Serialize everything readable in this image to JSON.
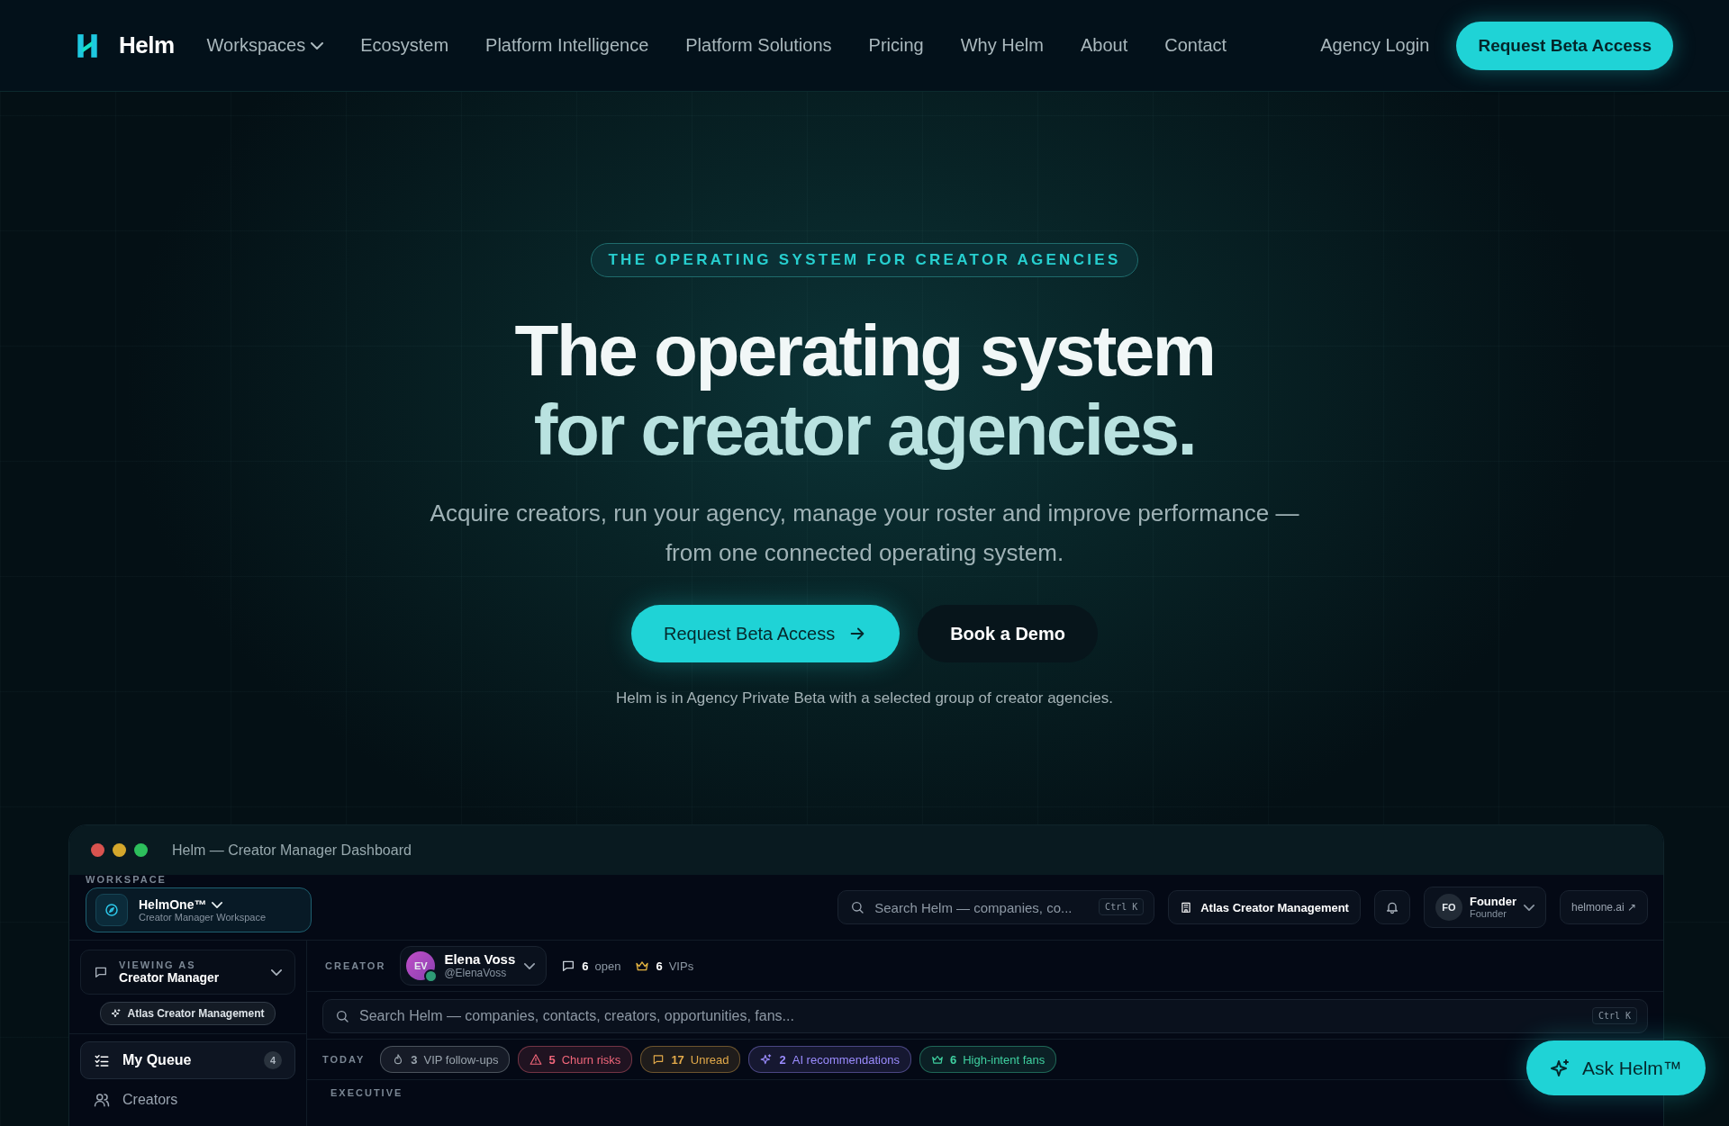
{
  "nav": {
    "logo": "Helm",
    "items": [
      {
        "label": "Workspaces",
        "dropdown": true
      },
      {
        "label": "Ecosystem",
        "dropdown": false
      },
      {
        "label": "Platform Intelligence",
        "dropdown": false
      },
      {
        "label": "Platform Solutions",
        "dropdown": false
      },
      {
        "label": "Pricing",
        "dropdown": false
      },
      {
        "label": "Why Helm",
        "dropdown": false
      },
      {
        "label": "About",
        "dropdown": false
      },
      {
        "label": "Contact",
        "dropdown": false
      }
    ],
    "login": "Agency Login",
    "cta": "Request Beta Access"
  },
  "hero": {
    "eyebrow": "THE OPERATING SYSTEM FOR CREATOR AGENCIES",
    "title_lines": [
      "The operating system",
      "for creator agencies."
    ],
    "subtitle": "Acquire creators, run your agency, manage your roster and improve performance — from one connected operating system.",
    "primary": "Request Beta Access",
    "secondary": "Book a Demo",
    "note": "Helm is in Agency Private Beta with a selected group of creator agencies."
  },
  "dashboard": {
    "title": "Helm — Creator Manager Dashboard",
    "workspace": {
      "label": "WORKSPACE",
      "name": "HelmOne™",
      "subtitle": "Creator Manager Workspace"
    },
    "topbar": {
      "search": {
        "placeholder": "Search Helm — companies, co...",
        "shortcut": "Ctrl K"
      },
      "org": "Atlas Creator Management",
      "user": {
        "initials": "FO",
        "name": "Founder",
        "role": "Founder"
      },
      "link": "helmone.ai ↗"
    },
    "sidebar": {
      "viewing": {
        "label": "VIEWING AS",
        "value": "Creator Manager"
      },
      "org_chip": "Atlas Creator Management",
      "items": [
        {
          "kind": "queue",
          "label": "My Queue",
          "count": "4",
          "selected": true
        },
        {
          "kind": "users",
          "label": "Creators",
          "selected": false
        }
      ]
    },
    "creator_bar": {
      "label": "CREATOR",
      "creator": {
        "initials": "EV",
        "name": "Elena Voss",
        "handle": "@ElenaVoss",
        "online": true
      },
      "stats": [
        {
          "kind": "chat",
          "value": "6",
          "label": "open"
        },
        {
          "kind": "crown",
          "value": "6",
          "label": "VIPs"
        }
      ]
    },
    "search": {
      "placeholder": "Search Helm — companies, contacts, creators, opportunities, fans...",
      "shortcut": "Ctrl K"
    },
    "today": {
      "label": "TODAY",
      "chips": [
        {
          "kind": "flame",
          "value": "3",
          "label": "VIP follow-ups",
          "color": "#9aa4ad"
        },
        {
          "kind": "alert",
          "value": "5",
          "label": "Churn risks",
          "color": "#f0667a"
        },
        {
          "kind": "chat",
          "value": "17",
          "label": "Unread",
          "color": "#e3aa4a"
        },
        {
          "kind": "sparkle",
          "value": "2",
          "label": "AI recommendations",
          "color": "#9b8cff"
        },
        {
          "kind": "crown",
          "value": "6",
          "label": "High-intent fans",
          "color": "#3fd0a0"
        }
      ]
    },
    "section_heading": "EXECUTIVE"
  },
  "ask_button": "Ask Helm™"
}
